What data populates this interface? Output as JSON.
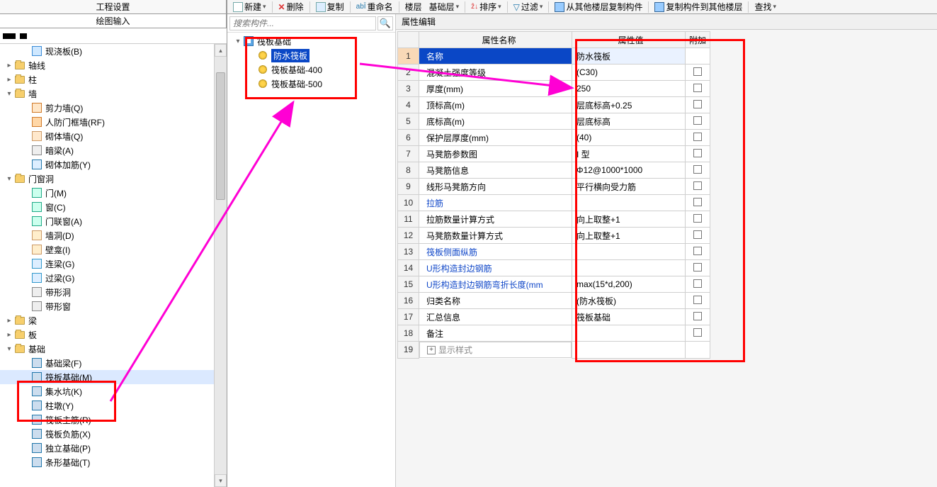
{
  "toolbar": {
    "new": "新建",
    "delete": "删除",
    "copy": "复制",
    "rename": "重命名",
    "floor": "楼层",
    "baselayer": "基础层",
    "sort": "排序",
    "filter": "过滤",
    "copyFromFloor": "从其他楼层复制构件",
    "copyToFloor": "复制构件到其他楼层",
    "find": "查找"
  },
  "leftTabs": {
    "t1": "工程设置",
    "t2": "绘图输入"
  },
  "leftTree": {
    "xianjiaoban": "现浇板(B)",
    "zhouxian": "轴线",
    "zhu": "柱",
    "qiang": "墙",
    "jianliqiang": "剪力墙(Q)",
    "renfang": "人防门框墙(RF)",
    "qitiqiang": "砌体墙(Q)",
    "anliang": "暗梁(A)",
    "qitijiajin": "砌体加筋(Y)",
    "menchuangdong": "门窗洞",
    "men": "门(M)",
    "chuang": "窗(C)",
    "menlianchuang": "门联窗(A)",
    "qiangdong": "墙洞(D)",
    "bikan": "壁龛(I)",
    "lianliang": "连梁(G)",
    "guoliang": "过梁(G)",
    "daixingdong": "带形洞",
    "daixingchuang": "带形窗",
    "liang": "梁",
    "ban": "板",
    "jichu": "基础",
    "jichuliang": "基础梁(F)",
    "fabanjichu": "筏板基础(M)",
    "jishuikeng": "集水坑(K)",
    "zhudun": "柱墩(Y)",
    "fabanzhujin": "筏板主筋(R)",
    "fabanfujin": "筏板负筋(X)",
    "dulijichu": "独立基础(P)",
    "tiaoxingjichu": "条形基础(T)"
  },
  "search": {
    "placeholder": "搜索构件..."
  },
  "midTree": {
    "root": "筏板基础",
    "item1": "防水筏板",
    "item2": "筏板基础-400",
    "item3": "筏板基础-500"
  },
  "propTitle": "属性编辑",
  "gridHeaders": {
    "name": "属性名称",
    "value": "属性值",
    "add": "附加"
  },
  "rows": [
    {
      "n": "1",
      "name": "名称",
      "val": "防水筏板",
      "chk": false,
      "hl": true
    },
    {
      "n": "2",
      "name": "混凝土强度等级",
      "val": "(C30)",
      "chk": true
    },
    {
      "n": "3",
      "name": "厚度(mm)",
      "val": "250",
      "chk": true
    },
    {
      "n": "4",
      "name": "顶标高(m)",
      "val": "层底标高+0.25",
      "chk": true
    },
    {
      "n": "5",
      "name": "底标高(m)",
      "val": "层底标高",
      "chk": true
    },
    {
      "n": "6",
      "name": "保护层厚度(mm)",
      "val": "(40)",
      "chk": true
    },
    {
      "n": "7",
      "name": "马凳筋参数图",
      "val": "I 型",
      "chk": true
    },
    {
      "n": "8",
      "name": "马凳筋信息",
      "val": "Φ12@1000*1000",
      "chk": true
    },
    {
      "n": "9",
      "name": "线形马凳筋方向",
      "val": "平行横向受力筋",
      "chk": true
    },
    {
      "n": "10",
      "name": "拉筋",
      "val": "",
      "chk": true,
      "link": true
    },
    {
      "n": "11",
      "name": "拉筋数量计算方式",
      "val": "向上取整+1",
      "chk": true
    },
    {
      "n": "12",
      "name": "马凳筋数量计算方式",
      "val": "向上取整+1",
      "chk": true
    },
    {
      "n": "13",
      "name": "筏板侧面纵筋",
      "val": "",
      "chk": true,
      "link": true
    },
    {
      "n": "14",
      "name": "U形构造封边钢筋",
      "val": "",
      "chk": true,
      "link": true
    },
    {
      "n": "15",
      "name": "U形构造封边钢筋弯折长度(mm",
      "val": "max(15*d,200)",
      "chk": true,
      "link": true
    },
    {
      "n": "16",
      "name": "归类名称",
      "val": "(防水筏板)",
      "chk": true
    },
    {
      "n": "17",
      "name": "汇总信息",
      "val": "筏板基础",
      "chk": true
    },
    {
      "n": "18",
      "name": "备注",
      "val": "",
      "chk": true
    },
    {
      "n": "19",
      "name": "显示样式",
      "val": "",
      "chk": false,
      "last": true
    }
  ]
}
